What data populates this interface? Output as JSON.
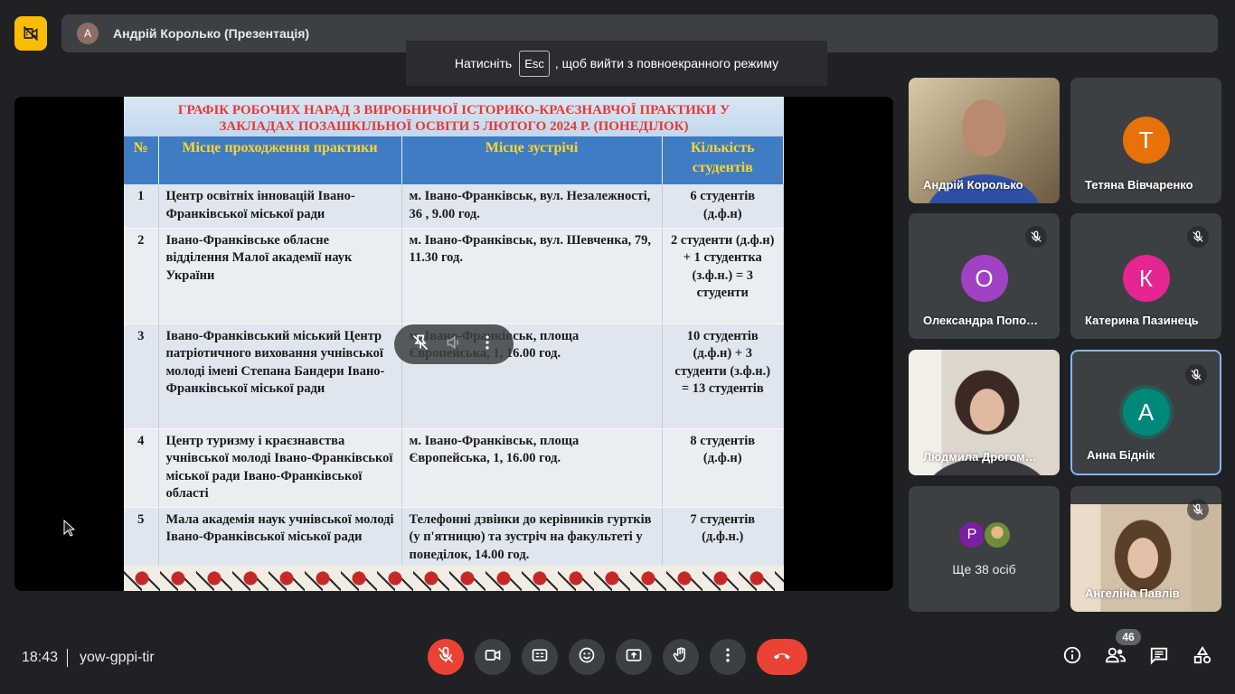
{
  "top_bar": {
    "presenter_initial": "А",
    "presenter_title": "Андрій Королько (Презентація)"
  },
  "esc_toast": {
    "before": "Натисніть",
    "key": "Esc",
    "after": ", щоб вийти з повноекранного режиму"
  },
  "slide": {
    "title_line1": "ГРАФІК РОБОЧИХ НАРАД З ВИРОБНИЧОЇ ІСТОРИКО-КРАЄЗНАВЧОЇ ПРАКТИКИ У",
    "title_line2": "ЗАКЛАДАХ ПОЗАШКІЛЬНОЇ ОСВІТИ 5 ЛЮТОГО 2024 Р. (ПОНЕДІЛОК)",
    "headers": [
      "№",
      "Місце проходження практики",
      "Місце зустрічі",
      "Кількість студентів"
    ],
    "rows": [
      {
        "num": "1",
        "place": "Центр освітніх інновацій Івано-Франківської міської ради",
        "meeting": "м. Івано-Франківськ, вул. Незалежності, 36 , 9.00 год.",
        "count": "6 студентів (д.ф.н)"
      },
      {
        "num": "2",
        "place": "Івано-Франківське обласне відділення Малої академії наук України",
        "meeting": "м. Івано-Франківськ, вул. Шевченка, 79, 11.30 год.",
        "count": "2 студенти (д.ф.н) + 1 студентка (з.ф.н.) = 3 студенти"
      },
      {
        "num": "3",
        "place": "Івано-Франківський міський Центр патріотичного виховання учнівської молоді імені Степана Бандери Івано-Франківської міської ради",
        "meeting": "м. Івано-Франківськ, площа Європейська, 1, 16.00 год.",
        "count": "10 студентів (д.ф.н) + 3 студенти (з.ф.н.) = 13 студентів"
      },
      {
        "num": "4",
        "place": "Центр туризму і краєзнавства учнівської молоді Івано-Франківської міської ради Івано-Франківської області",
        "meeting": "м. Івано-Франківськ, площа Європейська, 1, 16.00 год.",
        "count": "8 студентів (д.ф.н)"
      },
      {
        "num": "5",
        "place": "Мала академія наук учнівської молоді Івано-Франківської міської ради",
        "meeting": "Телефонні дзвінки до керівників гуртків (у п'ятницю) та зустріч на факультеті у понеділок, 14.00 год.",
        "count": "7 студентів (д.ф.н.)"
      }
    ]
  },
  "participants": [
    {
      "name": "Андрій Королько",
      "type": "video"
    },
    {
      "name": "Тетяна Вівчаренко",
      "initial": "Т",
      "color": "#e8710a"
    },
    {
      "name": "Олександра Попо…",
      "initial": "О",
      "color": "#a142c4"
    },
    {
      "name": "Катерина Пазинець",
      "initial": "К",
      "color": "#e52592"
    },
    {
      "name": "Людмила Дрогом…",
      "type": "video"
    },
    {
      "name": "Анна Біднік",
      "initial": "А",
      "color": "#00897b"
    },
    {
      "more_label": "Ще 38 осіб",
      "initial": "P",
      "color": "#7b1fa2"
    },
    {
      "name": "Ангеліна Павлів",
      "type": "video"
    }
  ],
  "bottom_bar": {
    "time": "18:43",
    "meeting_code": "yow-gppi-tir",
    "people_count": "46"
  },
  "colors": {
    "background": "#202124",
    "tile": "#3c4043",
    "danger": "#ea4335",
    "accent": "#fbbc04",
    "active_border": "#8ab4f8"
  },
  "icons": [
    "no-camera-icon",
    "mic-off-icon",
    "camera-icon",
    "captions-icon",
    "emoji-icon",
    "present-icon",
    "raise-hand-icon",
    "more-options-icon",
    "hangup-icon",
    "info-icon",
    "people-icon",
    "chat-icon",
    "activities-icon"
  ]
}
